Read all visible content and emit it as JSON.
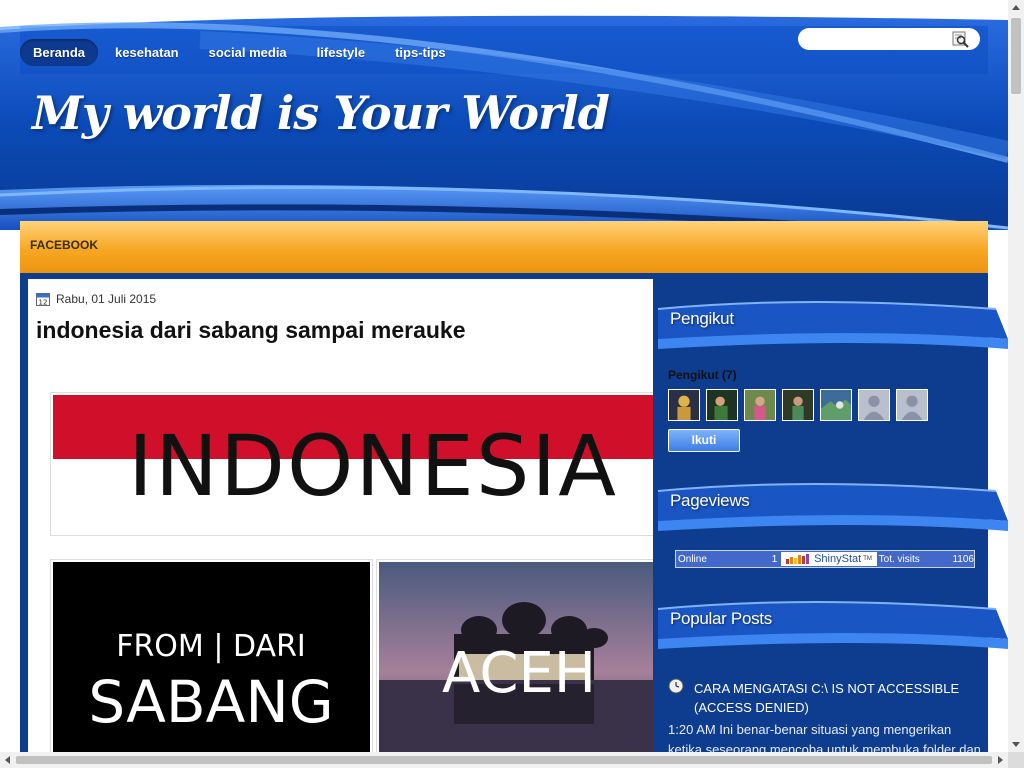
{
  "nav": {
    "items": [
      {
        "label": "Beranda",
        "active": true
      },
      {
        "label": "kesehatan",
        "active": false
      },
      {
        "label": "social media",
        "active": false
      },
      {
        "label": "lifestyle",
        "active": false
      },
      {
        "label": "tips-tips",
        "active": false
      }
    ]
  },
  "search": {
    "value": "",
    "placeholder": ""
  },
  "blog": {
    "title": "My world is Your World"
  },
  "orange_bar": {
    "link": "FACEBOOK"
  },
  "post": {
    "date": "Rabu, 01 Juli 2015",
    "title": "indonesia dari sabang sampai merauke",
    "images": {
      "indonesia_text": "INDONESIA",
      "sabang_line1": "FROM | DARI",
      "sabang_line2": "SABANG",
      "aceh_text": "ACEH"
    }
  },
  "sidebar": {
    "followers": {
      "title": "Pengikut",
      "label": "Pengikut (7)",
      "follow_button": "Ikuti"
    },
    "pageviews": {
      "title": "Pageviews",
      "online_label": "Online",
      "online_count": "1",
      "brand": "ShinyStat",
      "tm": "TM",
      "total_label": "Tot. visits",
      "total_count": "1106"
    },
    "popular": {
      "title": "Popular Posts",
      "post_title": "CARA MENGATASI C:\\ IS NOT ACCESSIBLE (ACCESS DENIED)",
      "snippet": " 1:20 AM Ini benar-benar situasi yang mengerikan ketika seseorang mencoba untuk membuka folder dan"
    }
  },
  "colors": {
    "header_blue": "#0b4bb8",
    "orange": "#f6a823",
    "sidebar_blue": "#0e3c8f",
    "flag_red": "#d0102a"
  },
  "icons": {
    "search": "search-magnifier-icon",
    "calendar": "calendar-icon",
    "clock": "clock-icon"
  }
}
